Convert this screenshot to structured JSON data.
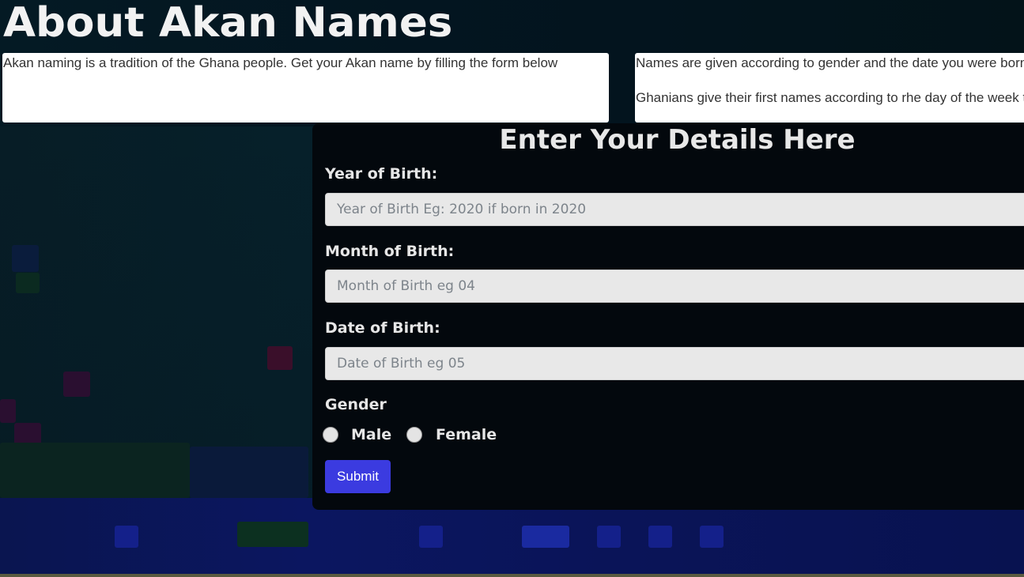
{
  "header": {
    "title": "About Akan Names"
  },
  "info": {
    "left_text": "Akan naming is a tradition of the Ghana people. Get your Akan name by filling the form below",
    "right_line1": "Names are given according to gender and the date you were born",
    "right_line2": "Ghanians give their first names according to rhe day of the week they were born"
  },
  "form": {
    "title": "Enter Your Details Here",
    "year_label": "Year of Birth:",
    "year_placeholder": "Year of Birth Eg: 2020 if born in 2020",
    "month_label": "Month of Birth:",
    "month_placeholder": "Month of Birth eg 04",
    "date_label": "Date of Birth:",
    "date_placeholder": "Date of Birth eg 05",
    "gender_label": "Gender",
    "male_label": "Male",
    "female_label": "Female",
    "submit_label": "Submit"
  },
  "colors": {
    "submit": "#3b3be0",
    "panel": "#03080d",
    "input_bg": "#e8e8e8"
  }
}
